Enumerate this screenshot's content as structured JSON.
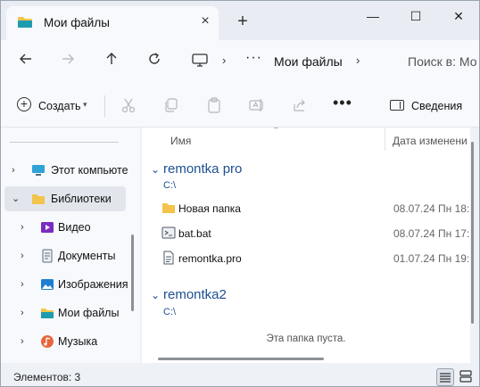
{
  "tab": {
    "title": "Мои файлы",
    "close_icon": "close-icon"
  },
  "window_controls": {
    "minimize": "—",
    "maximize": "☐",
    "close": "✕"
  },
  "address": {
    "crumbs": [
      "Мои файлы"
    ],
    "search_placeholder": "Поиск в: Мо"
  },
  "toolbar": {
    "create_label": "Создать",
    "details_label": "Сведения"
  },
  "sidebar": {
    "items": [
      {
        "label": "Этот компьюте",
        "icon": "computer-icon",
        "expanded": false
      },
      {
        "label": "Библиотеки",
        "icon": "libraries-folder-icon",
        "expanded": true,
        "selected": true
      },
      {
        "label": "Видео",
        "icon": "video-icon"
      },
      {
        "label": "Документы",
        "icon": "documents-icon"
      },
      {
        "label": "Изображения",
        "icon": "images-icon"
      },
      {
        "label": "Мои файлы",
        "icon": "my-files-folder-icon"
      },
      {
        "label": "Музыка",
        "icon": "music-icon"
      }
    ]
  },
  "columns": {
    "name": "Имя",
    "date": "Дата изменени"
  },
  "groups": [
    {
      "title": "remontka pro",
      "path": "C:\\",
      "rows": [
        {
          "name": "Новая папка",
          "date": "08.07.24 Пн 18:",
          "icon": "folder-icon"
        },
        {
          "name": "bat.bat",
          "date": "08.07.24 Пн 17:",
          "icon": "batch-file-icon"
        },
        {
          "name": "remontka.pro",
          "date": "01.07.24 Пн 19:",
          "icon": "file-icon"
        }
      ]
    },
    {
      "title": "remontka2",
      "path": "C:\\",
      "empty_message": "Эта папка пуста."
    }
  ],
  "status": {
    "items_count": "Элементов: 3"
  },
  "colors": {
    "accent": "#1d4f91",
    "folder": "#f3c34b",
    "background": "#f7f9fc"
  }
}
